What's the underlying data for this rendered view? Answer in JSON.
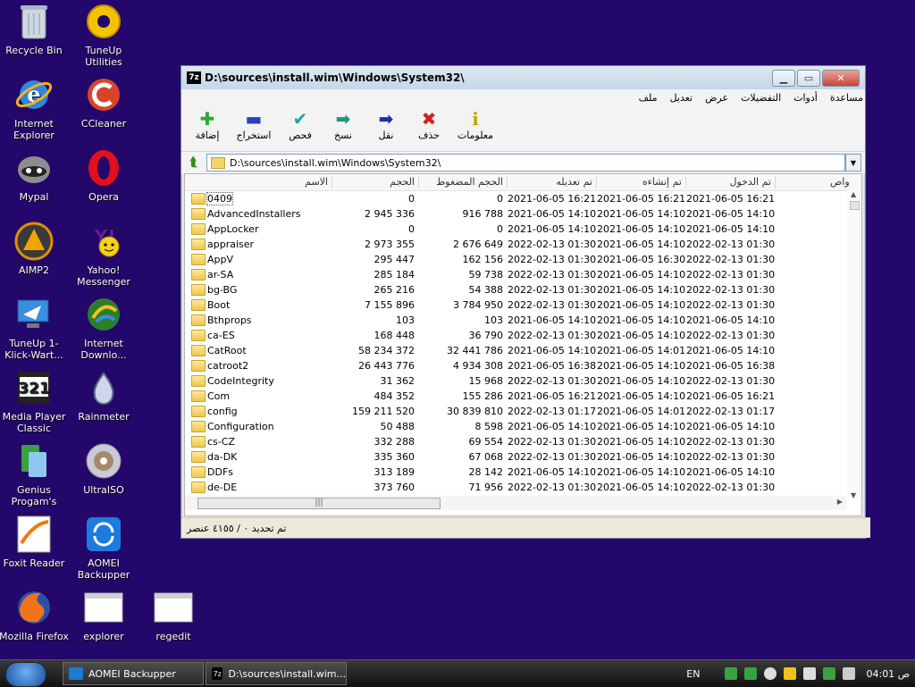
{
  "desktop": {
    "icons": [
      {
        "label": "Recycle Bin",
        "icon": "recycle-bin-icon"
      },
      {
        "label": "TuneUp Utilities",
        "icon": "tuneup-icon"
      },
      {
        "label": "Internet Explorer",
        "icon": "internet-explorer-icon"
      },
      {
        "label": "CCleaner",
        "icon": "ccleaner-icon"
      },
      {
        "label": "Mypal",
        "icon": "mypal-icon"
      },
      {
        "label": "Opera",
        "icon": "opera-icon"
      },
      {
        "label": "AIMP2",
        "icon": "aimp-icon"
      },
      {
        "label": "Yahoo! Messenger",
        "icon": "yahoo-messenger-icon"
      },
      {
        "label": "TuneUp 1-Klick-Wart...",
        "icon": "tuneup-oneclick-icon"
      },
      {
        "label": "Internet Downlo...",
        "icon": "idm-icon"
      },
      {
        "label": "Media Player Classic",
        "icon": "media-player-classic-icon"
      },
      {
        "label": "Rainmeter",
        "icon": "rainmeter-icon"
      },
      {
        "label": "Genius Progam's",
        "icon": "genius-programs-icon"
      },
      {
        "label": "UltraISO",
        "icon": "ultraiso-icon"
      },
      {
        "label": "Foxit Reader",
        "icon": "foxit-reader-icon"
      },
      {
        "label": "AOMEI Backupper",
        "icon": "aomei-backupper-icon"
      },
      {
        "label": "Mozilla Firefox",
        "icon": "firefox-icon"
      },
      {
        "label": "explorer",
        "icon": "explorer-window-icon"
      },
      {
        "label": "regedit",
        "icon": "regedit-window-icon"
      }
    ]
  },
  "window": {
    "title": "D:\\sources\\install.wim\\Windows\\System32\\",
    "app_badge": "7z",
    "menu": [
      "ملف",
      "تعديل",
      "عرض",
      "التفضيلات",
      "أدوات",
      "مساعدة"
    ],
    "toolbar": [
      {
        "label": "إضافة",
        "icon": "add-icon",
        "color": "#2fa82f",
        "glyph": "✚"
      },
      {
        "label": "استخراج",
        "icon": "extract-icon",
        "color": "#2c3fbf",
        "glyph": "▬"
      },
      {
        "label": "فحص",
        "icon": "test-icon",
        "color": "#1aa7a7",
        "glyph": "✔"
      },
      {
        "label": "نسخ",
        "icon": "copy-icon",
        "color": "#1a9a7a",
        "glyph": "➡"
      },
      {
        "label": "نقل",
        "icon": "move-icon",
        "color": "#1e2fa8",
        "glyph": "➡"
      },
      {
        "label": "حذف",
        "icon": "delete-icon",
        "color": "#d42020",
        "glyph": "✖"
      },
      {
        "label": "معلومات",
        "icon": "info-icon",
        "color": "#c9a000",
        "glyph": "i"
      }
    ],
    "address": "D:\\sources\\install.wim\\Windows\\System32\\",
    "columns": {
      "name": "الاسم",
      "size": "الحجم",
      "packed": "الحجم المضغوط",
      "modified": "تم تعديله",
      "created": "تم إنشاءه",
      "accessed": "تم الدخول",
      "attr": "واص"
    },
    "rows": [
      {
        "name": "0409",
        "size": "0",
        "packed": "0",
        "modified": "2021-06-05 16:21",
        "created": "2021-06-05 16:21",
        "accessed": "2021-06-05 16:21"
      },
      {
        "name": "AdvancedInstallers",
        "size": "2 945 336",
        "packed": "916 788",
        "modified": "2021-06-05 14:10",
        "created": "2021-06-05 14:10",
        "accessed": "2021-06-05 14:10"
      },
      {
        "name": "AppLocker",
        "size": "0",
        "packed": "0",
        "modified": "2021-06-05 14:10",
        "created": "2021-06-05 14:10",
        "accessed": "2021-06-05 14:10"
      },
      {
        "name": "appraiser",
        "size": "2 973 355",
        "packed": "2 676 649",
        "modified": "2022-02-13 01:30",
        "created": "2021-06-05 14:10",
        "accessed": "2022-02-13 01:30"
      },
      {
        "name": "AppV",
        "size": "295 447",
        "packed": "162 156",
        "modified": "2022-02-13 01:30",
        "created": "2021-06-05 16:30",
        "accessed": "2022-02-13 01:30"
      },
      {
        "name": "ar-SA",
        "size": "285 184",
        "packed": "59 738",
        "modified": "2022-02-13 01:30",
        "created": "2021-06-05 14:10",
        "accessed": "2022-02-13 01:30"
      },
      {
        "name": "bg-BG",
        "size": "265 216",
        "packed": "54 388",
        "modified": "2022-02-13 01:30",
        "created": "2021-06-05 14:10",
        "accessed": "2022-02-13 01:30"
      },
      {
        "name": "Boot",
        "size": "7 155 896",
        "packed": "3 784 950",
        "modified": "2022-02-13 01:30",
        "created": "2021-06-05 14:10",
        "accessed": "2022-02-13 01:30"
      },
      {
        "name": "Bthprops",
        "size": "103",
        "packed": "103",
        "modified": "2021-06-05 14:10",
        "created": "2021-06-05 14:10",
        "accessed": "2021-06-05 14:10"
      },
      {
        "name": "ca-ES",
        "size": "168 448",
        "packed": "36 790",
        "modified": "2022-02-13 01:30",
        "created": "2021-06-05 14:10",
        "accessed": "2022-02-13 01:30"
      },
      {
        "name": "CatRoot",
        "size": "58 234 372",
        "packed": "32 441 786",
        "modified": "2021-06-05 14:10",
        "created": "2021-06-05 14:01",
        "accessed": "2021-06-05 14:10"
      },
      {
        "name": "catroot2",
        "size": "26 443 776",
        "packed": "4 934 308",
        "modified": "2021-06-05 16:38",
        "created": "2021-06-05 14:10",
        "accessed": "2021-06-05 16:38"
      },
      {
        "name": "CodeIntegrity",
        "size": "31 362",
        "packed": "15 968",
        "modified": "2022-02-13 01:30",
        "created": "2021-06-05 14:10",
        "accessed": "2022-02-13 01:30"
      },
      {
        "name": "Com",
        "size": "484 352",
        "packed": "155 286",
        "modified": "2021-06-05 16:21",
        "created": "2021-06-05 14:10",
        "accessed": "2021-06-05 16:21"
      },
      {
        "name": "config",
        "size": "159 211 520",
        "packed": "30 839 810",
        "modified": "2022-02-13 01:17",
        "created": "2021-06-05 14:01",
        "accessed": "2022-02-13 01:17"
      },
      {
        "name": "Configuration",
        "size": "50 488",
        "packed": "8 598",
        "modified": "2021-06-05 14:10",
        "created": "2021-06-05 14:10",
        "accessed": "2021-06-05 14:10"
      },
      {
        "name": "cs-CZ",
        "size": "332 288",
        "packed": "69 554",
        "modified": "2022-02-13 01:30",
        "created": "2021-06-05 14:10",
        "accessed": "2022-02-13 01:30"
      },
      {
        "name": "da-DK",
        "size": "335 360",
        "packed": "67 068",
        "modified": "2022-02-13 01:30",
        "created": "2021-06-05 14:10",
        "accessed": "2022-02-13 01:30"
      },
      {
        "name": "DDFs",
        "size": "313 189",
        "packed": "28 142",
        "modified": "2021-06-05 14:10",
        "created": "2021-06-05 14:10",
        "accessed": "2021-06-05 14:10"
      },
      {
        "name": "de-DE",
        "size": "373 760",
        "packed": "71 956",
        "modified": "2022-02-13 01:30",
        "created": "2021-06-05 14:10",
        "accessed": "2022-02-13 01:30"
      }
    ],
    "status": "تم تحديد ٠ / ٤١٥٥ عنصر"
  },
  "taskbar": {
    "buttons": [
      {
        "label": "AOMEI Backupper",
        "icon": "aomei-task-icon"
      },
      {
        "label": "D:\\sources\\install.wim...",
        "icon": "7zip-task-icon"
      }
    ],
    "lang": "EN",
    "clock": "04:01 ص"
  }
}
